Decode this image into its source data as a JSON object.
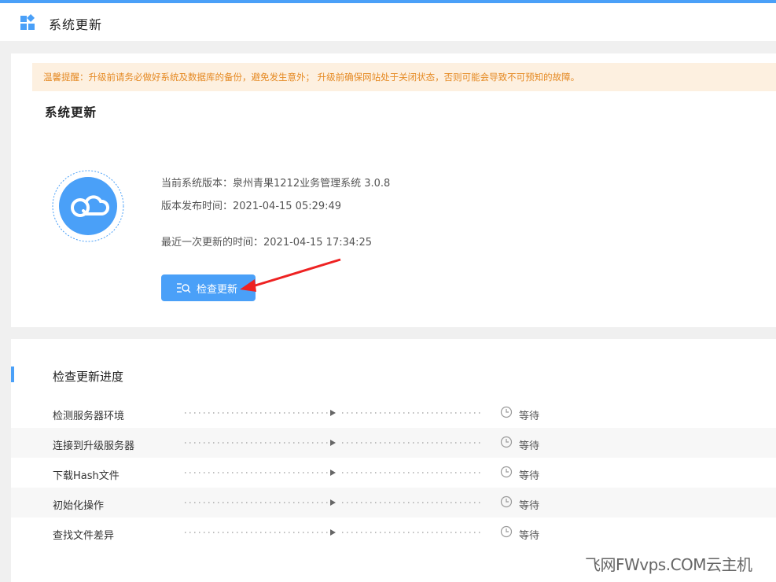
{
  "header": {
    "title": "系统更新"
  },
  "warning": {
    "text": "温馨提醒：升级前请务必做好系统及数据库的备份，避免发生意外；  升级前确保网站处于关闭状态，否则可能会导致不可预知的故障。"
  },
  "update_panel": {
    "section_title": "系统更新",
    "current_version": "当前系统版本：泉州青果1212业务管理系统 3.0.8",
    "release_time": "版本发布时间：2021-04-15 05:29:49",
    "last_update": "最近一次更新的时间：2021-04-15 17:34:25",
    "check_button": "检查更新"
  },
  "progress_panel": {
    "title": "检查更新进度",
    "steps": [
      {
        "label": "检测服务器环境",
        "status": "等待"
      },
      {
        "label": "连接到升级服务器",
        "status": "等待"
      },
      {
        "label": "下载Hash文件",
        "status": "等待"
      },
      {
        "label": "初始化操作",
        "status": "等待"
      },
      {
        "label": "查找文件差异",
        "status": "等待"
      }
    ]
  },
  "watermark": "飞网FWvps.COM云主机",
  "colors": {
    "accent": "#4aa0f8",
    "warning_bg": "#fdf0e0",
    "warning_text": "#e58a24",
    "arrow": "#ee2222"
  },
  "icons": {
    "header": "grid-diamond-icon",
    "avatar": "cloud-icon",
    "button": "search-list-icon",
    "status": "clock-icon"
  }
}
